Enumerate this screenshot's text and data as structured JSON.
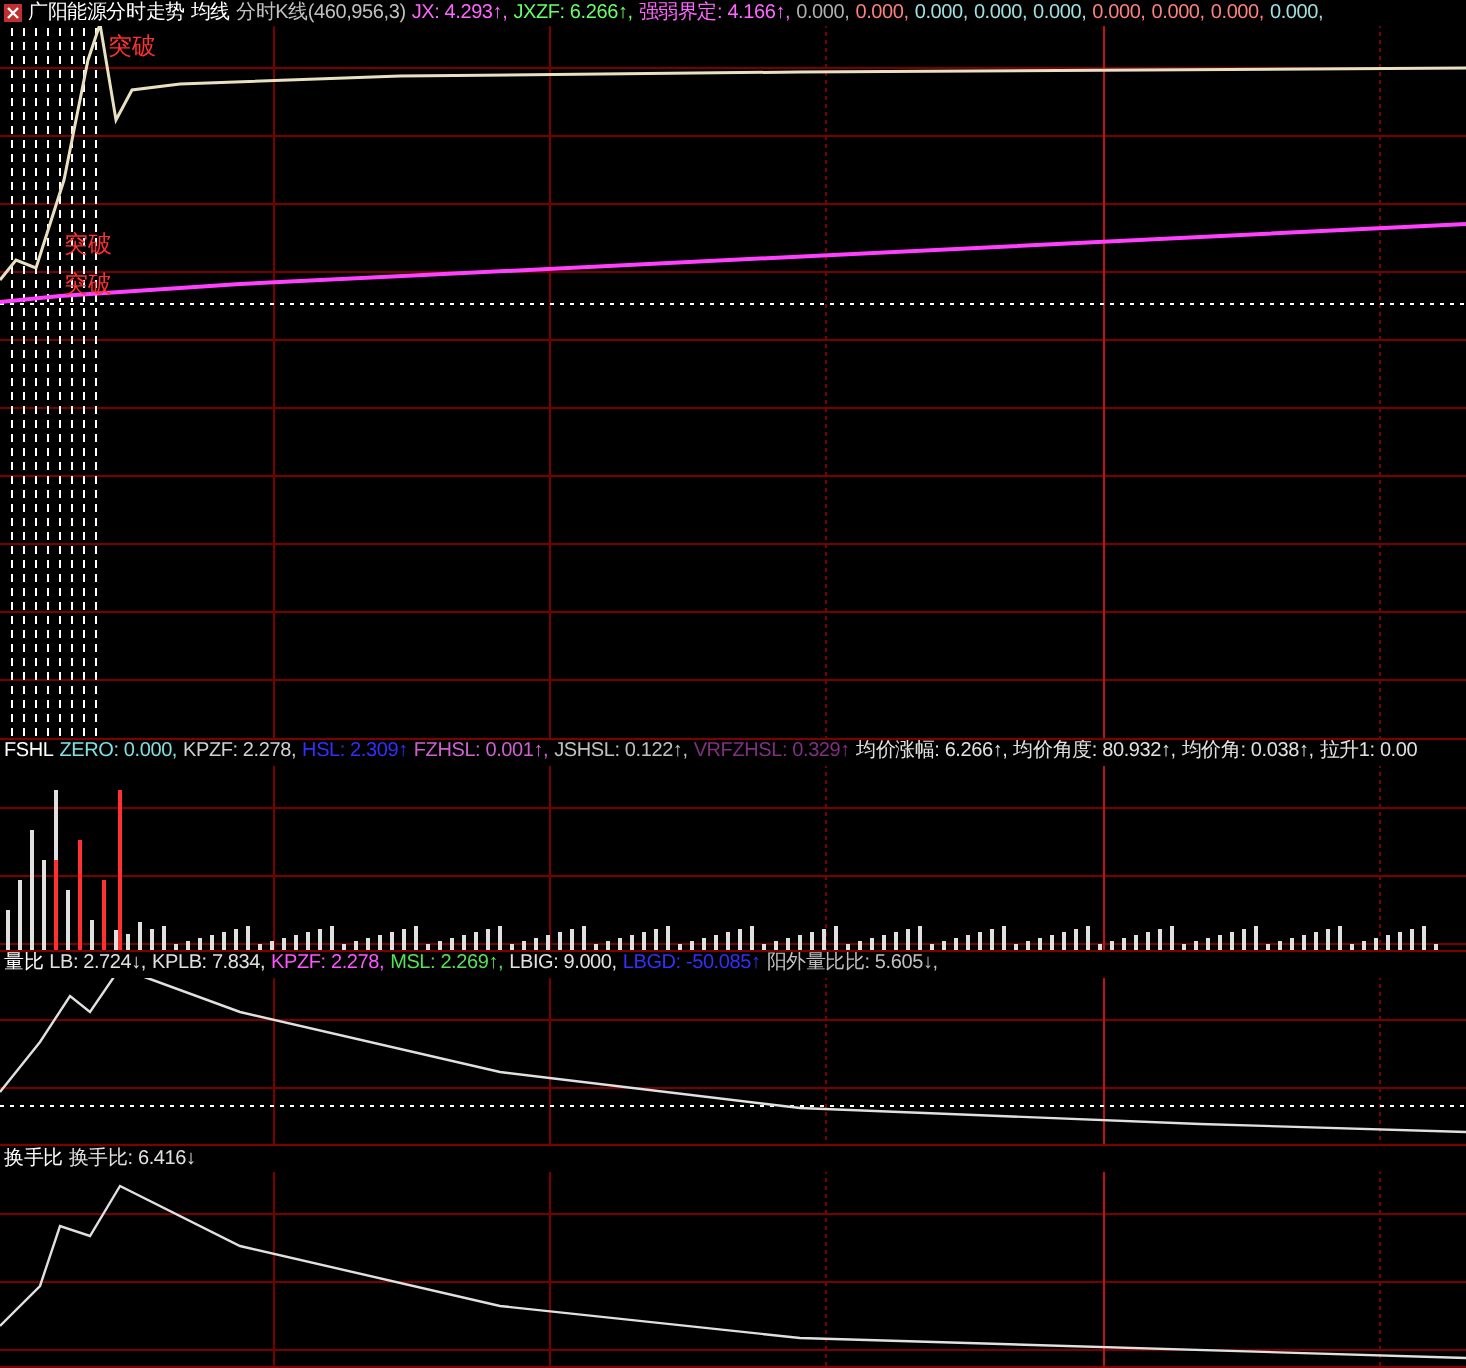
{
  "panels": [
    {
      "kind": "price",
      "title": "广阳能源分时走势",
      "items": [
        {
          "text": "均线",
          "color": "#ffffff"
        },
        {
          "text": "分时K线(460,956,3)",
          "color": "#c0c0c0"
        },
        {
          "text": "JX: 4.293↑,",
          "color": "#ff66ff"
        },
        {
          "text": "JXZF: 6.266↑,",
          "color": "#66ff66"
        },
        {
          "text": "强弱界定: 4.166↑,",
          "color": "#ff66ff"
        },
        {
          "text": "0.000,",
          "color": "#b0b0b0"
        },
        {
          "text": "0.000,",
          "color": "#ff8080"
        },
        {
          "text": "0.000,",
          "color": "#a0e0e0"
        },
        {
          "text": "0.000,",
          "color": "#a0e0e0"
        },
        {
          "text": "0.000,",
          "color": "#a0e0e0"
        },
        {
          "text": "0.000,",
          "color": "#ff8080"
        },
        {
          "text": "0.000,",
          "color": "#ff8080"
        },
        {
          "text": "0.000,",
          "color": "#ff8080"
        },
        {
          "text": "0.000,",
          "color": "#a0e0e0"
        }
      ],
      "marks": [
        "突破",
        "突破",
        "突破"
      ]
    },
    {
      "kind": "volume",
      "title": "FSHL",
      "items": [
        {
          "text": "ZERO: 0.000,",
          "color": "#80e0e0"
        },
        {
          "text": "KPZF: 2.278,",
          "color": "#d0d0d0"
        },
        {
          "text": "HSL: 2.309↑",
          "color": "#3030ff"
        },
        {
          "text": "FZHSL: 0.001↑,",
          "color": "#d060d0"
        },
        {
          "text": "JSHSL: 0.122↑,",
          "color": "#c0c0c0"
        },
        {
          "text": "VRFZHSL: 0.329↑",
          "color": "#803080"
        },
        {
          "text": "均价涨幅: 6.266↑,",
          "color": "#e0e0e0"
        },
        {
          "text": "均价角度: 80.932↑,",
          "color": "#e0e0e0"
        },
        {
          "text": "均价角: 0.038↑,",
          "color": "#e0e0e0"
        },
        {
          "text": "拉升1: 0.00",
          "color": "#e0e0e0"
        }
      ]
    },
    {
      "kind": "ratio",
      "title": "量比",
      "items": [
        {
          "text": "LB: 2.724↓,",
          "color": "#e0e0e0"
        },
        {
          "text": "KPLB: 7.834,",
          "color": "#e0e0e0"
        },
        {
          "text": "KPZF: 2.278,",
          "color": "#ff55ff"
        },
        {
          "text": "MSL: 2.269↑,",
          "color": "#55e055"
        },
        {
          "text": "LBIG: 9.000,",
          "color": "#e0e0e0"
        },
        {
          "text": "LBGD: -50.085↑",
          "color": "#3030ff"
        },
        {
          "text": "阳外量比比: 5.605↓,",
          "color": "#c0c0c0"
        }
      ]
    },
    {
      "kind": "turnover",
      "title": "换手比",
      "items": [
        {
          "text": "换手比: 6.416↓",
          "color": "#e0e0e0"
        }
      ]
    }
  ]
}
